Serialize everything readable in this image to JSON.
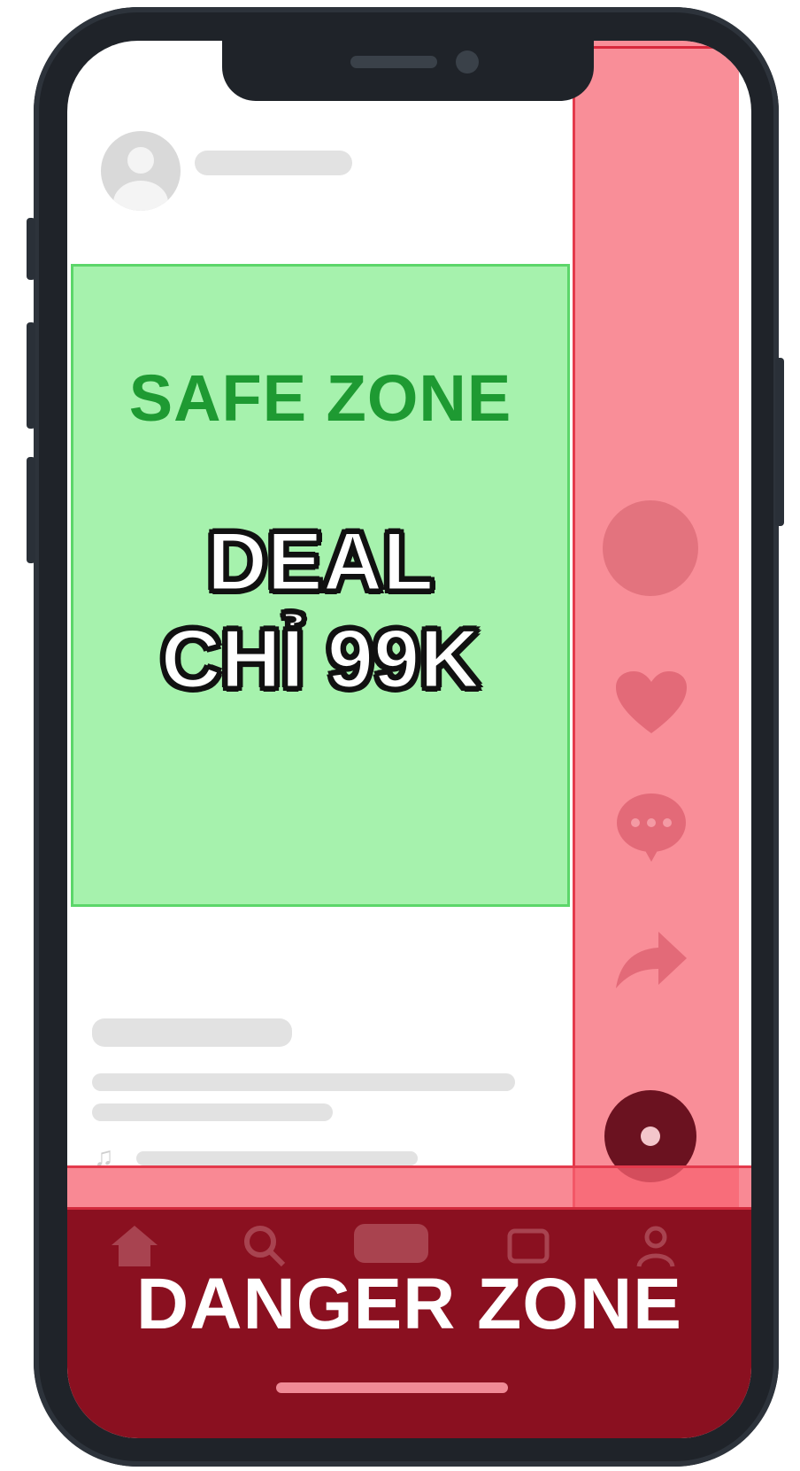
{
  "safe_zone": {
    "label": "SAFE ZONE"
  },
  "promo": {
    "line1": "DEAL",
    "line2": "CHỈ 99K"
  },
  "danger_zone": {
    "label": "DANGER ZONE"
  },
  "side_actions": [
    "profile-avatar",
    "heart-icon",
    "comment-icon",
    "share-icon",
    "music-disc-icon"
  ],
  "bottom_nav": [
    "home-icon",
    "search-icon",
    "create-icon",
    "inbox-icon",
    "profile-icon"
  ],
  "colors": {
    "safe_fill": "#a6f2ad",
    "safe_text": "#1e9a32",
    "danger_fill": "#f76270",
    "danger_dark": "#8a1020"
  }
}
